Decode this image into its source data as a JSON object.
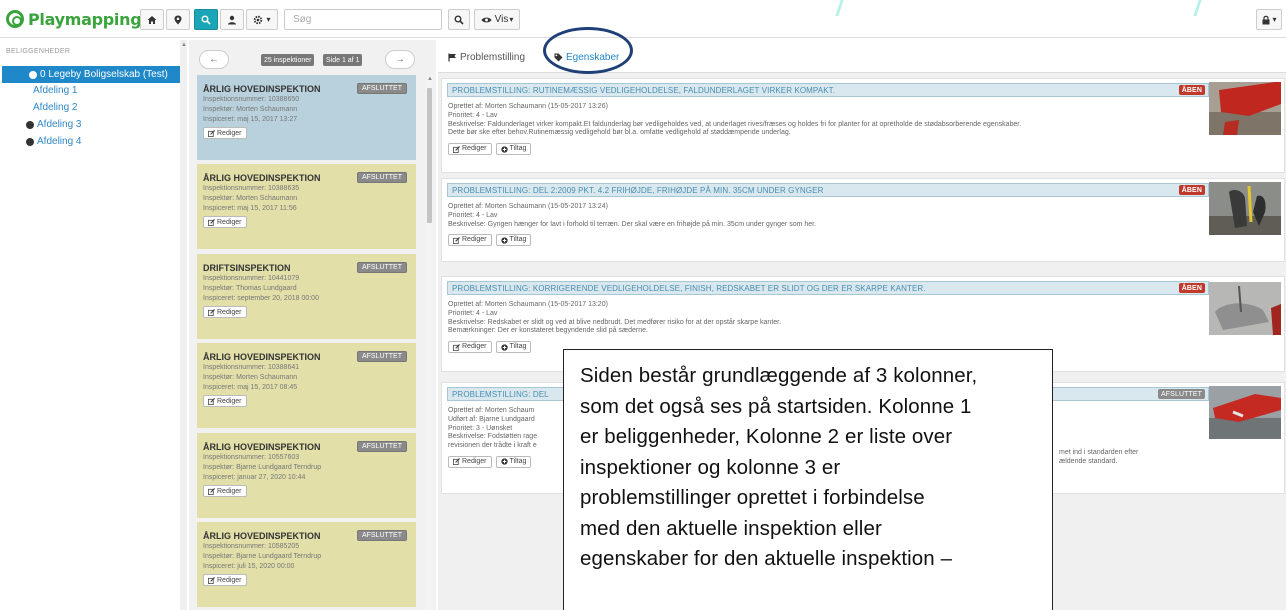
{
  "brand": {
    "name": "Playmapping",
    "color": "#3aa43c"
  },
  "topbar": {
    "buttons": [
      {
        "icon": "home-icon"
      },
      {
        "icon": "map-pin-icon"
      },
      {
        "icon": "search-icon",
        "active": true
      },
      {
        "icon": "user-icon"
      },
      {
        "icon": "settings-icon",
        "caret": "▾"
      }
    ],
    "search_placeholder": "Søg",
    "search_button_icon": "search-icon",
    "view_label": "Vis",
    "view_caret": "▾",
    "lock_icon": "lock-icon",
    "lock_caret": "▾"
  },
  "sidebar": {
    "heading": "BELIGGENHEDER",
    "selected": "0 Legeby Boligselskab (Test)",
    "items": [
      {
        "label": "Afdeling 1",
        "dot": false
      },
      {
        "label": "Afdeling 2",
        "dot": false
      },
      {
        "label": "Afdeling 3",
        "dot": true
      },
      {
        "label": "Afdeling 4",
        "dot": true
      }
    ]
  },
  "inspections": {
    "prev": "←",
    "next": "→",
    "count_badge": "25 inspektioner",
    "page_badge": "Side 1 af 1",
    "edit_label": "Rediger",
    "cards": [
      {
        "title": "ÅRLIG HOVEDINSPEKTION",
        "status": "AFSLUTTET",
        "number": "Inspektionsnummer: 10388650",
        "inspector": "Inspektør: Morten Schaumann",
        "date": "Inspiceret: maj 15, 2017 13:27",
        "selected": true
      },
      {
        "title": "ÅRLIG HOVEDINSPEKTION",
        "status": "AFSLUTTET",
        "number": "Inspektionsnummer: 10388635",
        "inspector": "Inspektør: Morten Schaumann",
        "date": "Inspiceret: maj 15, 2017 11:56"
      },
      {
        "title": "DRIFTSINSPEKTION",
        "status": "AFSLUTTET",
        "number": "Inspektionsnummer: 10441079",
        "inspector": "Inspektør: Thomas Lundgaard",
        "date": "Inspiceret: september 20, 2018 00:00"
      },
      {
        "title": "ÅRLIG HOVEDINSPEKTION",
        "status": "AFSLUTTET",
        "number": "Inspektionsnummer: 10388641",
        "inspector": "Inspektør: Morten Schaumann",
        "date": "Inspiceret: maj 15, 2017 08:45"
      },
      {
        "title": "ÅRLIG HOVEDINSPEKTION",
        "status": "AFSLUTTET",
        "number": "Inspektionsnummer: 10557603",
        "inspector": "Inspektør: Bjarne Lundgaard Terndrup",
        "date": "Inspiceret: januar 27, 2020 10:44"
      },
      {
        "title": "ÅRLIG HOVEDINSPEKTION",
        "status": "AFSLUTTET",
        "number": "Inspektionsnummer: 10585205",
        "inspector": "Inspektør: Bjarne Lundgaard Terndrup",
        "date": "Inspiceret: juli 15, 2020 00:00"
      }
    ]
  },
  "detail": {
    "tabs": {
      "problems": "Problemstilling",
      "properties": "Egenskaber"
    },
    "edit_label": "Rediger",
    "add_label": "Tiltag",
    "problems": [
      {
        "title": "PROBLEMSTILLING: RUTINEMÆSSIG VEDLIGEHOLDELSE, FALDUNDERLAGET VIRKER KOMPAKT.",
        "status": "ÅBEN",
        "lines": [
          "Oprettet af: Morten Schaumann (15-05-2017 13:26)",
          "Prioritet: 4 - Lav",
          "Beskrivelse: Faldunderlaget virker kompakt.Et faldunderlag bør vedligeholdes ved, at underlaget rives/fræses og holdes fri for planter for at opretholde de stødabsorberende egenskaber.",
          "Dette bør ske efter behov.Rutinemæssig vedligehold bør bl.a. omfatte vedligehold af støddæmpende underlag."
        ]
      },
      {
        "title": "PROBLEMSTILLING: DEL 2:2009 PKT. 4.2 FRIHØJDE, FRIHØJDE PÅ MIN. 35CM UNDER GYNGER",
        "status": "ÅBEN",
        "lines": [
          "Oprettet af: Morten Schaumann (15-05-2017 13:24)",
          "Prioritet: 4 - Lav",
          "Beskrivelse: Gyngen hænger for lavt i forhold til terræn. Der skal være en frihøjde på min. 35cm under gynger som her."
        ]
      },
      {
        "title": "PROBLEMSTILLING: KORRIGERENDE VEDLIGEHOLDELSE, FINISH, REDSKABET ER SLIDT OG DER ER SKARPE KANTER.",
        "status": "ÅBEN",
        "lines": [
          "Oprettet af: Morten Schaumann (15-05-2017 13:20)",
          "Prioritet: 4 - Lav",
          "Beskrivelse: Redskabet er slidt og ved at blive nedbrudt. Det medfører risiko for at der opstår skarpe kanter.",
          "Bemærkninger: Der er konstateret begyndende slid på sæderne."
        ]
      },
      {
        "title": "PROBLEMSTILLING: DEL",
        "status": "AFSLUTTET",
        "lines": [
          "Oprettet af: Morten Schaum",
          "Udført af: Bjarne Lundgaard",
          "Prioritet: 3 - Uønsket",
          "Beskrivelse: Fodstøtten rage",
          "revisionen der trådte i kraft e"
        ],
        "tail_lines": [
          "met ind i standarden efter",
          "ældende standard."
        ]
      }
    ]
  },
  "callout": {
    "lines": [
      "Siden består grundlæggende af 3 kolonner,",
      "som det også ses på startsiden. Kolonne 1",
      "er beliggenheder, Kolonne 2 er liste over",
      "inspektioner og kolonne 3 er",
      "problemstillinger oprettet i forbindelse",
      "med den aktuelle inspektion eller",
      "egenskaber for den aktuelle inspektion –"
    ]
  }
}
